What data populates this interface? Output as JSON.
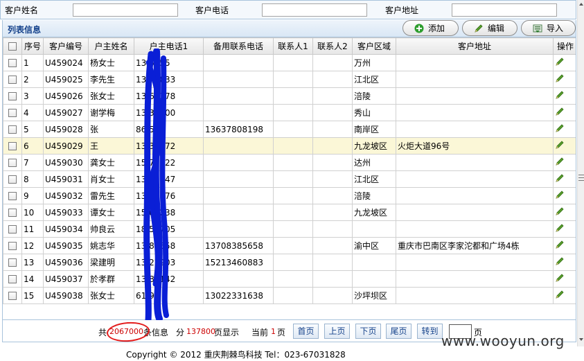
{
  "search": {
    "name_label": "客户姓名",
    "phone_label": "客户电话",
    "address_label": "客户地址",
    "name_value": "",
    "phone_value": "",
    "address_value": ""
  },
  "panel": {
    "title": "列表信息",
    "add_label": "添加",
    "edit_label": "编辑",
    "import_label": "导入"
  },
  "columns": [
    "序号",
    "客户编号",
    "户主姓名",
    "户主电话1",
    "备用联系电话",
    "联系人1",
    "联系人2",
    "客户区域",
    "客户地址",
    "操作"
  ],
  "rows": [
    {
      "no": "1",
      "code": "U459024",
      "name": "杨女士",
      "phone1": "13   5855",
      "phone2": "",
      "c1": "",
      "c2": "",
      "area": "万州",
      "addr": ""
    },
    {
      "no": "2",
      "code": "U459025",
      "name": "李先生",
      "phone1": "13   47833",
      "phone2": "",
      "c1": "",
      "c2": "",
      "area": "江北区",
      "addr": ""
    },
    {
      "no": "3",
      "code": "U459026",
      "name": "张女士",
      "phone1": "13   64378",
      "phone2": "",
      "c1": "",
      "c2": "",
      "area": "涪陵",
      "addr": ""
    },
    {
      "no": "4",
      "code": "U459027",
      "name": "谢学梅",
      "phone1": "13   33700",
      "phone2": "",
      "c1": "",
      "c2": "",
      "area": "秀山",
      "addr": ""
    },
    {
      "no": "5",
      "code": "U459028",
      "name": "张",
      "phone1": "86   53",
      "phone2": "13637808198",
      "c1": "",
      "c2": "",
      "area": "南岸区",
      "addr": ""
    },
    {
      "no": "6",
      "code": "U459029",
      "name": "王",
      "phone1": "13   30272",
      "phone2": "",
      "c1": "",
      "c2": "",
      "area": "九龙坡区",
      "addr": "火炬大道96号"
    },
    {
      "no": "7",
      "code": "U459030",
      "name": "龚女士",
      "phone1": "15   79222",
      "phone2": "",
      "c1": "",
      "c2": "",
      "area": "达州",
      "addr": ""
    },
    {
      "no": "8",
      "code": "U459031",
      "name": "肖女士",
      "phone1": "13   00447",
      "phone2": "",
      "c1": "",
      "c2": "",
      "area": "江北区",
      "addr": ""
    },
    {
      "no": "9",
      "code": "U459032",
      "name": "雷先生",
      "phone1": "13   79076",
      "phone2": "",
      "c1": "",
      "c2": "",
      "area": "涪陵",
      "addr": ""
    },
    {
      "no": "10",
      "code": "U459033",
      "name": "谭女士",
      "phone1": "15   66238",
      "phone2": "",
      "c1": "",
      "c2": "",
      "area": "九龙坡区",
      "addr": ""
    },
    {
      "no": "11",
      "code": "U459034",
      "name": "帅良云",
      "phone1": "18   57705",
      "phone2": "",
      "c1": "",
      "c2": "",
      "area": "",
      "addr": ""
    },
    {
      "no": "12",
      "code": "U459035",
      "name": "姚志华",
      "phone1": "13   85658",
      "phone2": "13708385658",
      "c1": "",
      "c2": "",
      "area": "渝中区",
      "addr": "重庆市巴南区李家沱都和广场4栋"
    },
    {
      "no": "13",
      "code": "U459036",
      "name": "梁建明",
      "phone1": "13   22903",
      "phone2": "15213460883",
      "c1": "",
      "c2": "",
      "area": "",
      "addr": ""
    },
    {
      "no": "14",
      "code": "U459037",
      "name": "於孝群",
      "phone1": "13   88142",
      "phone2": "",
      "c1": "",
      "c2": "",
      "area": "",
      "addr": ""
    },
    {
      "no": "15",
      "code": "U459038",
      "name": "张女士",
      "phone1": "61   91",
      "phone2": "13022331638",
      "c1": "",
      "c2": "",
      "area": "沙坪坝区",
      "addr": ""
    }
  ],
  "highlighted_row": 6,
  "pager": {
    "total_prefix": "共",
    "total_count": "2067000",
    "total_suffix": "条信息",
    "pages_prefix": "分",
    "pages_count": "137800",
    "pages_suffix": "页显示",
    "current_prefix": "当前",
    "current_page": "1",
    "current_suffix": "页",
    "first_label": "首页",
    "prev_label": "上页",
    "next_label": "下页",
    "last_label": "尾页",
    "goto_label": "转到",
    "goto_value": "",
    "page_unit": "页"
  },
  "footer": {
    "copyright": "Copyright © 2012 重庆荆棘鸟科技 Tel：023-67031828",
    "watermark": "www.wooyun.org"
  },
  "colors": {
    "header_text": "#15428b",
    "highlight_row": "#fbf7d7",
    "count_red": "#cc0000",
    "redaction": "#0a1fd6"
  }
}
